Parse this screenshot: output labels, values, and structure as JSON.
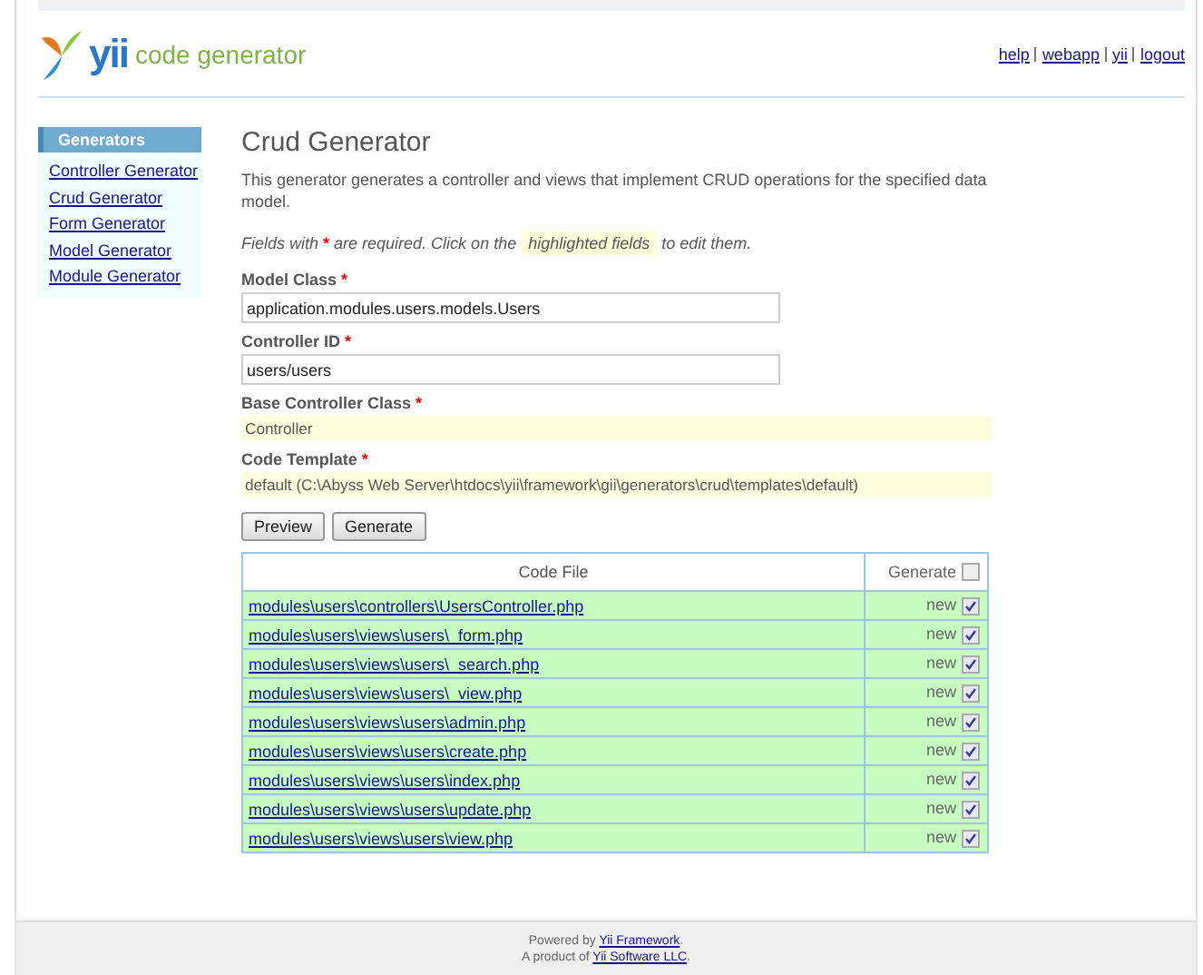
{
  "header": {
    "logo_text": "yii",
    "logo_subtitle": "code generator",
    "links": [
      "help",
      "webapp",
      "yii",
      "logout"
    ]
  },
  "sidebar": {
    "title": "Generators",
    "items": [
      {
        "label": "Controller Generator"
      },
      {
        "label": "Crud Generator"
      },
      {
        "label": "Form Generator"
      },
      {
        "label": "Model Generator"
      },
      {
        "label": "Module Generator"
      }
    ]
  },
  "main": {
    "title": "Crud Generator",
    "description": "This generator generates a controller and views that implement CRUD operations for the specified data model.",
    "hint": {
      "before": "Fields with",
      "mark": "*",
      "middle": "are required. Click on the",
      "highlight": "highlighted fields",
      "after": "to edit them."
    },
    "fields": [
      {
        "kind": "input",
        "label": "Model Class",
        "mark": "*",
        "value": "application.modules.users.models.Users"
      },
      {
        "kind": "input",
        "label": "Controller ID",
        "mark": "*",
        "value": "users/users"
      },
      {
        "kind": "sticky",
        "label": "Base Controller Class",
        "mark": "*",
        "value": "Controller"
      },
      {
        "kind": "sticky",
        "label": "Code Template",
        "mark": "*",
        "value": "default (C:\\Abyss Web Server\\htdocs\\yii\\framework\\gii\\generators\\crud\\templates\\default)"
      }
    ],
    "buttons": [
      "Preview",
      "Generate"
    ],
    "table": {
      "columns": [
        "Code File",
        "Generate"
      ],
      "header_checked": false,
      "rows": [
        {
          "file": "modules\\users\\controllers\\UsersController.php",
          "status": "new",
          "checked": true
        },
        {
          "file": "modules\\users\\views\\users\\_form.php",
          "status": "new",
          "checked": true
        },
        {
          "file": "modules\\users\\views\\users\\_search.php",
          "status": "new",
          "checked": true
        },
        {
          "file": "modules\\users\\views\\users\\_view.php",
          "status": "new",
          "checked": true
        },
        {
          "file": "modules\\users\\views\\users\\admin.php",
          "status": "new",
          "checked": true
        },
        {
          "file": "modules\\users\\views\\users\\create.php",
          "status": "new",
          "checked": true
        },
        {
          "file": "modules\\users\\views\\users\\index.php",
          "status": "new",
          "checked": true
        },
        {
          "file": "modules\\users\\views\\users\\update.php",
          "status": "new",
          "checked": true
        },
        {
          "file": "modules\\users\\views\\users\\view.php",
          "status": "new",
          "checked": true
        }
      ]
    }
  },
  "footer": [
    {
      "before": "Powered by",
      "link": "Yii Framework",
      "after": "."
    },
    {
      "before": "A product of",
      "link": "Yii Software LLC",
      "after": "."
    }
  ]
}
